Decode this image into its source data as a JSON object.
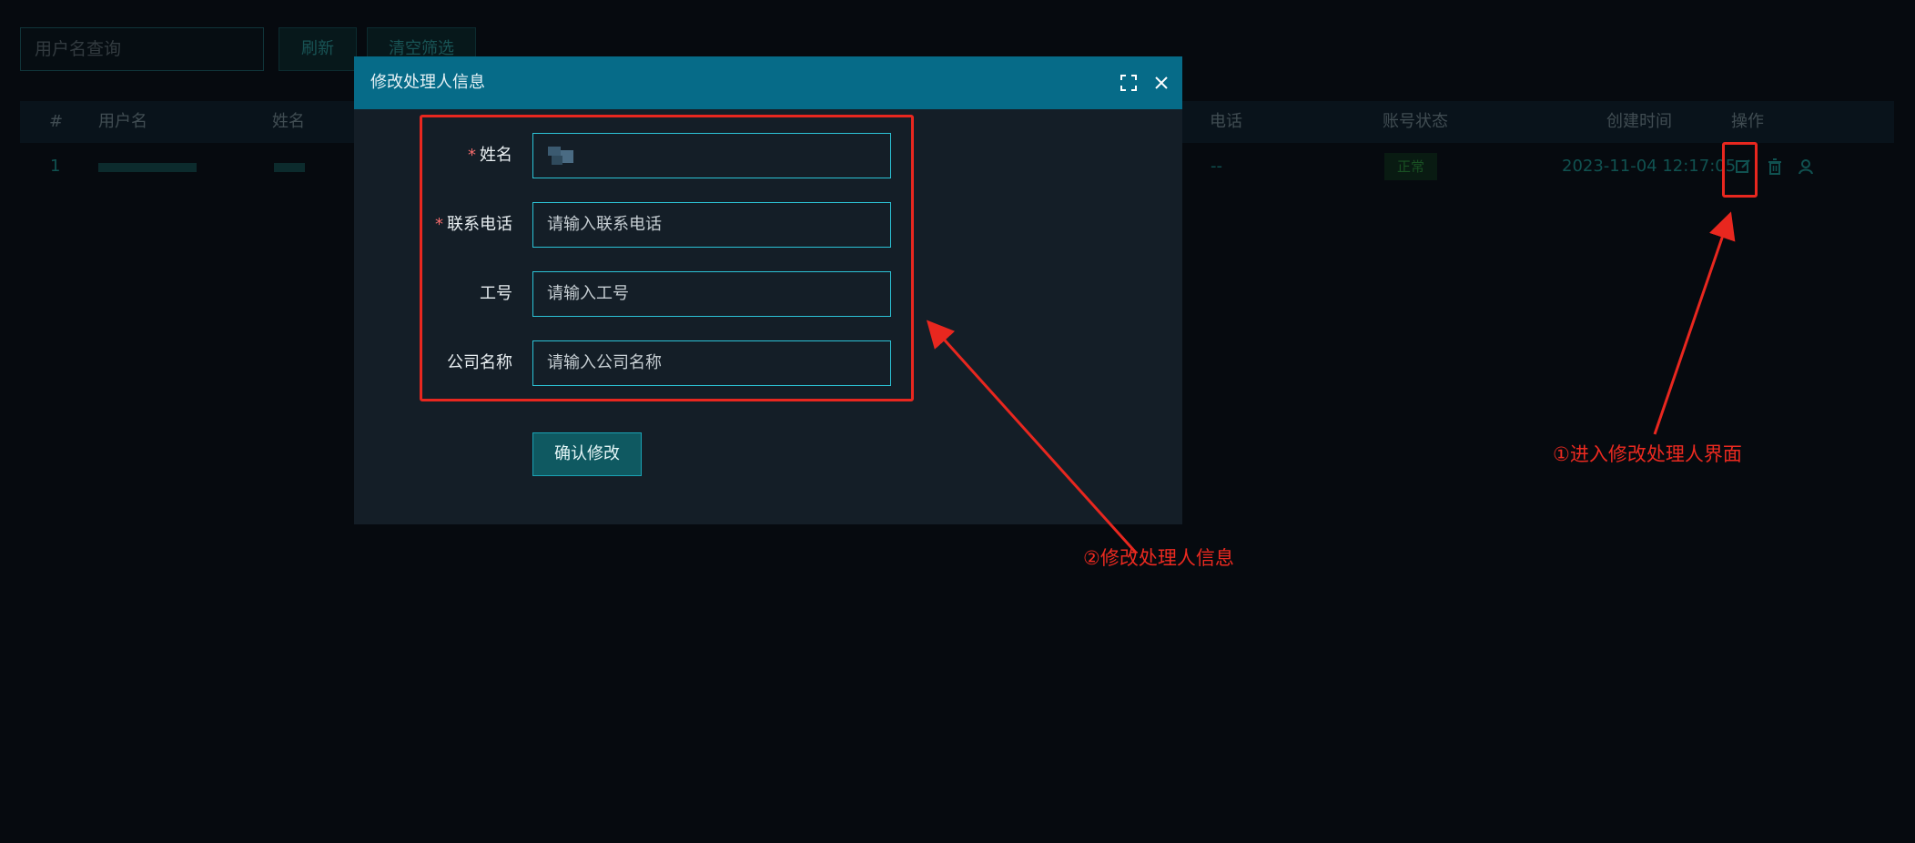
{
  "toolbar": {
    "search_placeholder": "用户名查询",
    "refresh_label": "刷新",
    "clear_filter_label": "清空筛选"
  },
  "table": {
    "headers": {
      "index": "#",
      "username": "用户名",
      "name": "姓名",
      "phone": "电话",
      "account_status": "账号状态",
      "created_time": "创建时间",
      "actions": "操作"
    },
    "rows": [
      {
        "index": "1",
        "phone": "--",
        "status": "正常",
        "created_time": "2023-11-04 12:17:05"
      }
    ]
  },
  "modal": {
    "title": "修改处理人信息",
    "fields": [
      {
        "label": "姓名",
        "required": "*",
        "value": "",
        "placeholder": ""
      },
      {
        "label": "联系电话",
        "required": "*",
        "value": "",
        "placeholder": "请输入联系电话"
      },
      {
        "label": "工号",
        "required": "",
        "value": "",
        "placeholder": "请输入工号"
      },
      {
        "label": "公司名称",
        "required": "",
        "value": "",
        "placeholder": "请输入公司名称"
      }
    ],
    "confirm_label": "确认修改",
    "icons": [
      "fullscreen-icon",
      "close-icon"
    ]
  },
  "annotations": {
    "step1": "①进入修改处理人界面",
    "step2": "②修改处理人信息",
    "color": "#ec2a20"
  },
  "colors": {
    "background": "#0b121a",
    "modal_header": "#066b88",
    "modal_body": "#141e27",
    "input_border": "#2cc3d6",
    "accent_teal": "#1d8c8a"
  }
}
